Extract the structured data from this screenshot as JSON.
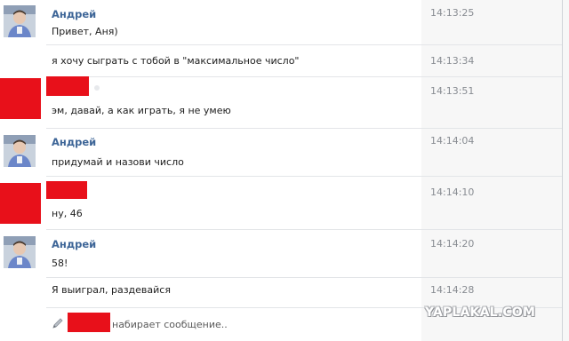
{
  "messages": [
    {
      "author": "Андрей",
      "text": "Привет, Аня)",
      "time": "14:13:25"
    },
    {
      "text": "я хочу сыграть с тобой в \"максимальное число\"",
      "time": "14:13:34"
    },
    {
      "text": "эм, давай, а как играть, я не умею",
      "time": "14:13:51"
    },
    {
      "author": "Андрей",
      "text": "придумай и назови число",
      "time": "14:14:04"
    },
    {
      "text": "ну, 46",
      "time": "14:14:10"
    },
    {
      "author": "Андрей",
      "text": "58!",
      "time": "14:14:20"
    },
    {
      "text": "Я выиграл, раздевайся",
      "time": "14:14:28"
    }
  ],
  "typing": {
    "text": "набирает сообщение.."
  },
  "watermark": "YAPLAKAL.COM",
  "colors": {
    "author_name": "#3d6597",
    "redaction": "#e8101a",
    "time": "#888c92"
  },
  "icons": {
    "typing": "pencil-icon"
  }
}
